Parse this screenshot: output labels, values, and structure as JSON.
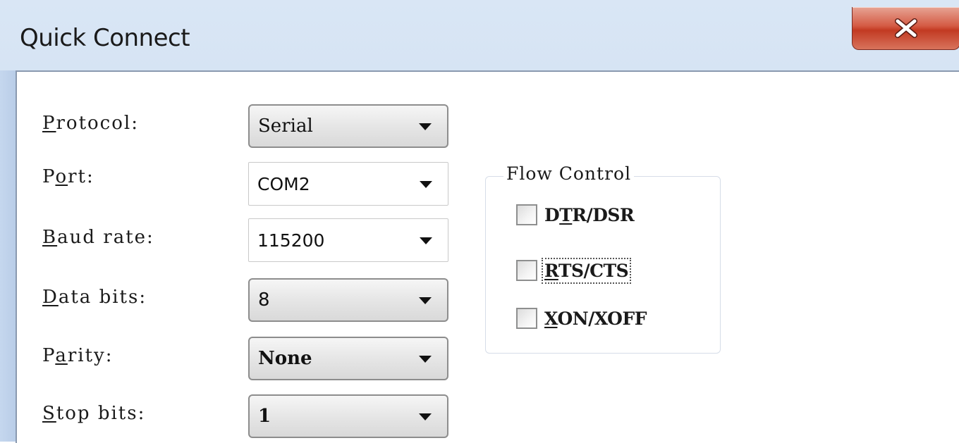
{
  "window": {
    "title": "Quick Connect",
    "close_icon": "close-icon"
  },
  "form": {
    "protocol": {
      "label_key": "P",
      "label_rest": "rotocol:",
      "value": "Serial"
    },
    "port": {
      "label_pre": "P",
      "label_key": "o",
      "label_rest": "rt:",
      "value": "COM2"
    },
    "baud_rate": {
      "label_key": "B",
      "label_rest": "aud rate:",
      "value": "115200"
    },
    "data_bits": {
      "label_key": "D",
      "label_rest": "ata bits:",
      "value": "8"
    },
    "parity": {
      "label_pre": "P",
      "label_key": "a",
      "label_rest": "rity:",
      "value": "None"
    },
    "stop_bits": {
      "label_key": "S",
      "label_rest": "top bits:",
      "value": "1"
    }
  },
  "flow_control": {
    "title": "Flow Control",
    "dtr_dsr": {
      "pre": "D",
      "key": "T",
      "rest": "R/DSR",
      "checked": false
    },
    "rts_cts": {
      "pre": "",
      "key": "R",
      "rest": "TS/CTS",
      "checked": false
    },
    "xon_xoff": {
      "pre": "",
      "key": "X",
      "rest": "ON/XOFF",
      "checked": false
    }
  },
  "colors": {
    "title_bar": "#c8daf0",
    "close_button": "#c23a22"
  }
}
